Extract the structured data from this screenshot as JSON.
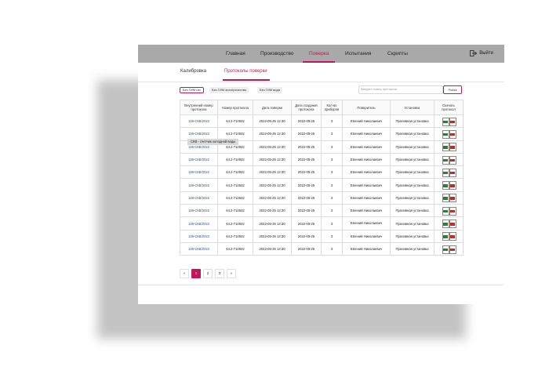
{
  "nav": {
    "items": [
      {
        "label": "Главная"
      },
      {
        "label": "Производство"
      },
      {
        "label": "Поверка"
      },
      {
        "label": "Испытания"
      },
      {
        "label": "Скрипты"
      }
    ],
    "active": "Поверка",
    "logout_label": "Выйти"
  },
  "subtabs": {
    "items": [
      {
        "label": "Калибровка"
      },
      {
        "label": "Протоколы поверки"
      }
    ],
    "active": "Протоколы поверки"
  },
  "filters": [
    {
      "label": "Без ГИМ газ"
    },
    {
      "label": "Без ГИМ электричество"
    },
    {
      "label": "Без ГИМ вода"
    }
  ],
  "search": {
    "placeholder": "Введите номер протокола",
    "button_label": "Поиск"
  },
  "table": {
    "headers": [
      "Внутренний номер протокола",
      "Номер протокола",
      "Дата поверки",
      "Дата создания протокола",
      "Кол-во приборов",
      "Поверитель",
      "Установка",
      "Скачать протокол"
    ],
    "rows": [
      {
        "internal": "138-СКВ/2022",
        "number": "64.2-714922",
        "verify_date": "2022-05-25 12:30",
        "created": "2022-05-25",
        "count": "3",
        "verifier": "Евгений Николаевич",
        "install": "Проливная установка"
      },
      {
        "internal": "138-СКВ/2022",
        "number": "64.2-714922",
        "verify_date": "2022-05-25 12:30",
        "created": "2022-05-25",
        "count": "3",
        "verifier": "Евгений Николаевич",
        "install": "Проливная установка"
      },
      {
        "internal": "138-СКВ/2022",
        "number": "64.2-714922",
        "verify_date": "2022-05-25 12:30",
        "created": "2022-05-25",
        "count": "3",
        "verifier": "Евгений Николаевич",
        "install": "Проливная установка"
      },
      {
        "internal": "138-СКВ/2022",
        "number": "64.2-714922",
        "verify_date": "2022-05-25 12:30",
        "created": "2022-05-25",
        "count": "3",
        "verifier": "Евгений Николаевич",
        "install": "Проливная установка"
      },
      {
        "internal": "138-СКВ/2022",
        "number": "64.2-714922",
        "verify_date": "2022-05-25 12:30",
        "created": "2022-05-25",
        "count": "3",
        "verifier": "Евгений Николаевич",
        "install": "Проливная установка"
      },
      {
        "internal": "138-СКВ/2022",
        "number": "64.2-714922",
        "verify_date": "2022-05-25 12:30",
        "created": "2022-05-25",
        "count": "3",
        "verifier": "Евгений Николаевич",
        "install": "Проливная установка"
      },
      {
        "internal": "138-СКВ/2022",
        "number": "64.2-714922",
        "verify_date": "2022-05-25 12:30",
        "created": "2022-05-25",
        "count": "3",
        "verifier": "Евгений Николаевич",
        "install": "Проливная установка"
      },
      {
        "internal": "138-СКВ/2022",
        "number": "64.2-714922",
        "verify_date": "2022-05-25 12:30",
        "created": "2022-05-25",
        "count": "3",
        "verifier": "Евгений Николаевич",
        "install": "Проливная установка"
      },
      {
        "internal": "138-СКВ/2022",
        "number": "64.2-714922",
        "verify_date": "2022-05-25 12:30",
        "created": "2022-05-25",
        "count": "3",
        "verifier": "Евгений Николаевич",
        "install": "Проливная установка"
      },
      {
        "internal": "138-СКВ/2022",
        "number": "64.2-714922",
        "verify_date": "2022-05-25 12:30",
        "created": "2022-05-25",
        "count": "3",
        "verifier": "Евгений Николаевич",
        "install": "Проливная установка"
      },
      {
        "internal": "138-СКВ/2022",
        "number": "64.2-714922",
        "verify_date": "2022-05-25 12:30",
        "created": "2022-05-25",
        "count": "3",
        "verifier": "Евгений Николаевич",
        "install": "Проливная установка"
      }
    ]
  },
  "tooltip": "СКВ - счетчик холодной воды",
  "pagination": {
    "prev": "«",
    "pages": [
      "1",
      "2",
      "3"
    ],
    "active": "1",
    "next": "»"
  },
  "colors": {
    "accent": "#c2185b",
    "topbar": "#a9a9a9",
    "link": "#2c4f8c",
    "download_green": "#2e7d32",
    "download_red": "#c62828"
  },
  "icons": [
    "logout-icon",
    "excel-download-icon",
    "pdf-download-icon"
  ]
}
